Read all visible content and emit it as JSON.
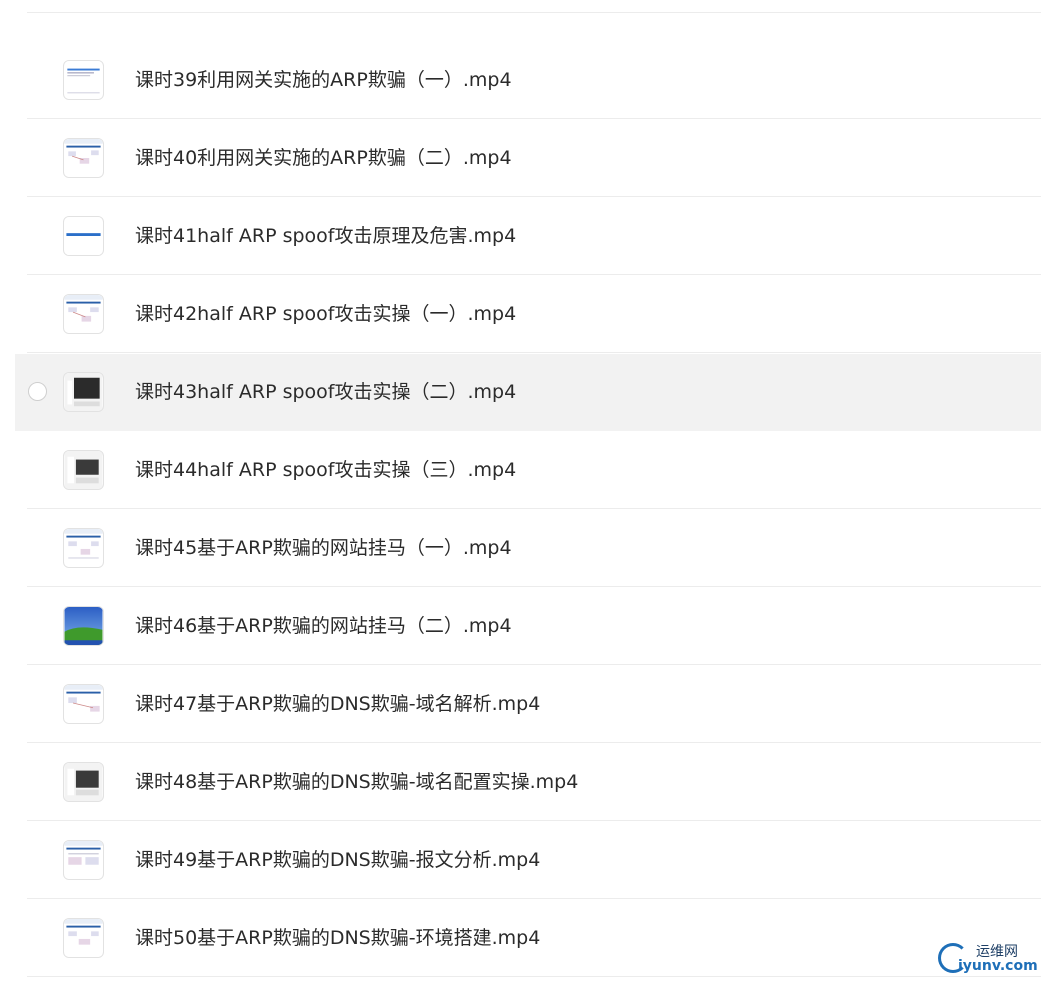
{
  "files": [
    {
      "name": "",
      "thumb": "doc-thumb"
    },
    {
      "name": "课时39利用网关实施的ARP欺骗（一）.mp4",
      "thumb": "doc-thumb"
    },
    {
      "name": "课时40利用网关实施的ARP欺骗（二）.mp4",
      "thumb": "diagram-thumb"
    },
    {
      "name": "课时41half ARP spoof攻击原理及危害.mp4",
      "thumb": "title-slide-thumb"
    },
    {
      "name": "课时42half ARP spoof攻击实操（一）.mp4",
      "thumb": "diagram-thumb"
    },
    {
      "name": "课时43half ARP spoof攻击实操（二）.mp4",
      "thumb": "terminal-thumb"
    },
    {
      "name": "课时44half ARP spoof攻击实操（三）.mp4",
      "thumb": "terminal-thumb"
    },
    {
      "name": "课时45基于ARP欺骗的网站挂马（一）.mp4",
      "thumb": "diagram-thumb"
    },
    {
      "name": "课时46基于ARP欺骗的网站挂马（二）.mp4",
      "thumb": "desktop-thumb"
    },
    {
      "name": "课时47基于ARP欺骗的DNS欺骗-域名解析.mp4",
      "thumb": "diagram-thumb"
    },
    {
      "name": "课时48基于ARP欺骗的DNS欺骗-域名配置实操.mp4",
      "thumb": "terminal-thumb"
    },
    {
      "name": "课时49基于ARP欺骗的DNS欺骗-报文分析.mp4",
      "thumb": "diagram-thumb"
    },
    {
      "name": "课时50基于ARP欺骗的DNS欺骗-环境搭建.mp4",
      "thumb": "diagram-thumb"
    }
  ],
  "watermark": {
    "cn": "运维网",
    "en": "iyunv.com",
    "icon": "logo-ring-icon"
  },
  "colors": {
    "row_highlight": "#f2f2f2",
    "divider": "#ececec",
    "brand": "#1e6fb8"
  }
}
